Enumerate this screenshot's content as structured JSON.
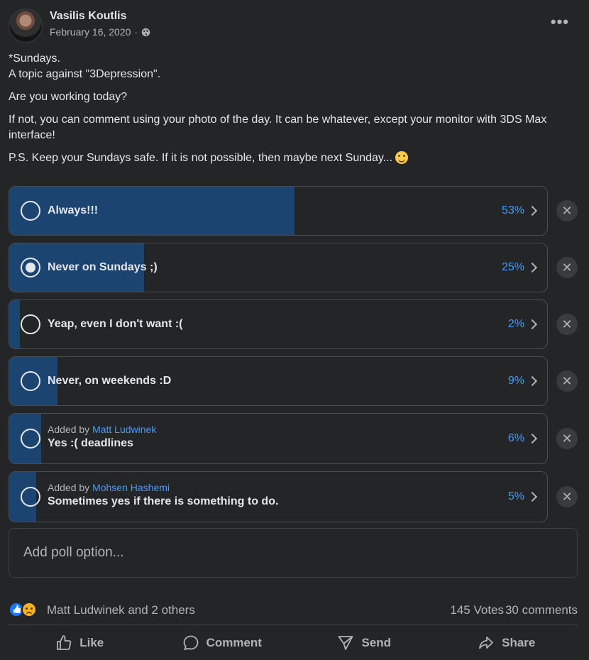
{
  "post": {
    "author": "Vasilis Koutlis",
    "date": "February 16, 2020",
    "separator": "·",
    "privacy_icon": "globe-icon",
    "more_label": "•••",
    "paragraphs": [
      "*Sundays.",
      "A topic against \"3Depression\".",
      "Are you working today?",
      "If not, you can comment using your photo of the day. It can be whatever, except your monitor with 3DS Max interface!",
      "P.S. Keep your Sundays safe. If it is not possible, then maybe next Sunday..."
    ]
  },
  "poll": {
    "options": [
      {
        "label": "Always!!!",
        "percent_text": "53%",
        "percent": 53,
        "selected": false
      },
      {
        "label": "Never on Sundays ;)",
        "percent_text": "25%",
        "percent": 25,
        "selected": true
      },
      {
        "label": "Yeap, even I don't want :(",
        "percent_text": "2%",
        "percent": 2,
        "selected": false
      },
      {
        "label": "Never, on weekends :D",
        "percent_text": "9%",
        "percent": 9,
        "selected": false
      },
      {
        "label": "Yes :( deadlines",
        "percent_text": "6%",
        "percent": 6,
        "selected": false,
        "added_prefix": "Added by",
        "added_by": "Matt Ludwinek"
      },
      {
        "label": "Sometimes yes if there is something to do.",
        "percent_text": "5%",
        "percent": 5,
        "selected": false,
        "added_prefix": "Added by",
        "added_by": "Mohsen Hashemi"
      }
    ],
    "add_option_placeholder": "Add poll option..."
  },
  "stats": {
    "reactions_text": "Matt Ludwinek and 2 others",
    "votes": "145 Votes",
    "comments": "30 comments"
  },
  "actions": {
    "like": "Like",
    "comment": "Comment",
    "send": "Send",
    "share": "Share"
  },
  "colors": {
    "background": "#242526",
    "bar_fill": "#1c4470",
    "link": "#4599ff",
    "text": "#e4e6eb",
    "muted": "#b0b3b8"
  }
}
